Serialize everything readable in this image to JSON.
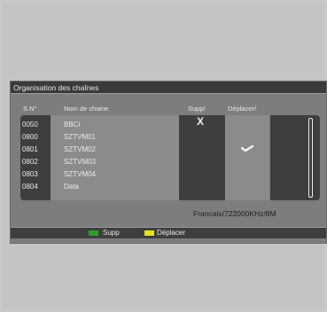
{
  "dialog": {
    "title": "Organisation des chaînes"
  },
  "table": {
    "headers": {
      "sn": "S.N°",
      "name": "Nom de chaine",
      "supp": "Supp/",
      "move": "Déplacer/"
    },
    "rows": [
      {
        "num": "0050",
        "name": "BBCi"
      },
      {
        "num": "0800",
        "name": "SZTVM01"
      },
      {
        "num": "0801",
        "name": "SZTVM02"
      },
      {
        "num": "0802",
        "name": "SZTVM03"
      },
      {
        "num": "0803",
        "name": "SZTVM04"
      },
      {
        "num": "0804",
        "name": "Data"
      }
    ],
    "supp_mark": "X"
  },
  "status": {
    "frequency": "Francais/722000KHz/8M"
  },
  "footer": {
    "keys": [
      {
        "label": "Supp",
        "color": "#2aa02a"
      },
      {
        "label": "Déplacer",
        "color": "#e8e21a"
      }
    ]
  }
}
